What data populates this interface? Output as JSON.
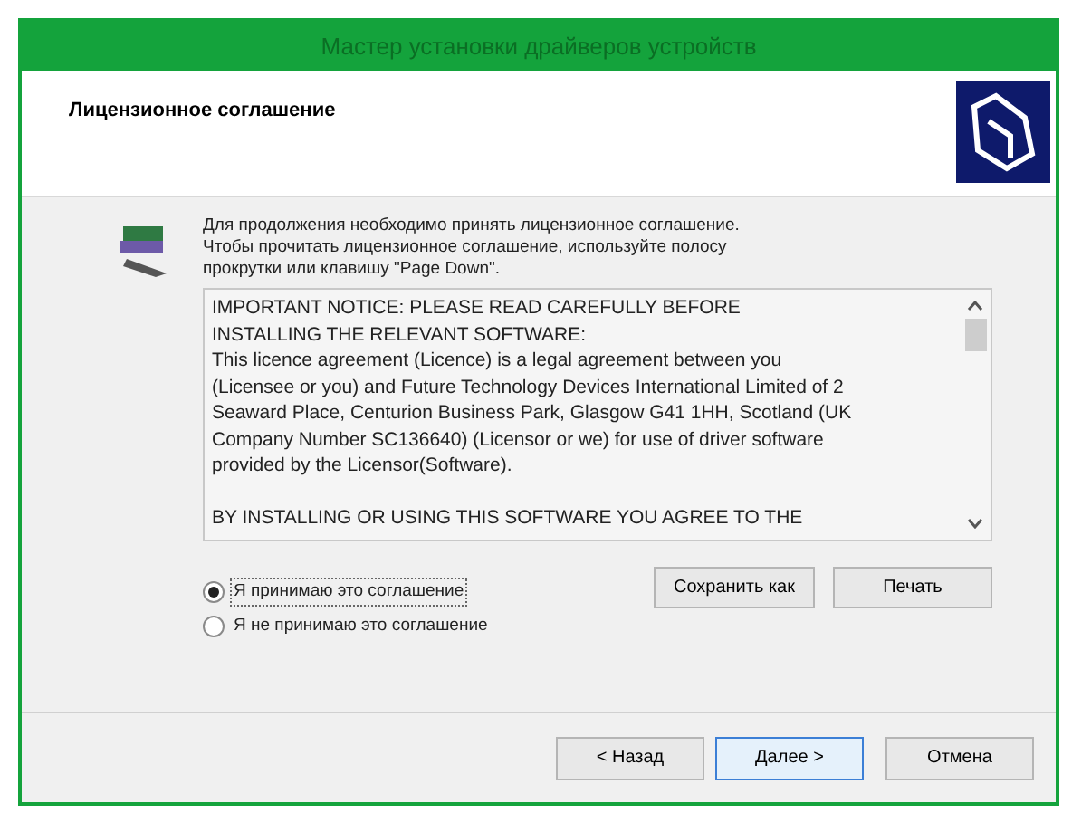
{
  "window": {
    "title": "Мастер установки драйверов устройств"
  },
  "header": {
    "title": "Лицензионное соглашение"
  },
  "instructions": [
    "Для продолжения необходимо принять лицензионное соглашение.",
    "Чтобы прочитать лицензионное соглашение, используйте полосу",
    "прокрутки или клавишу \"Page Down\"."
  ],
  "license_paragraphs": [
    [
      "IMPORTANT NOTICE: PLEASE READ CAREFULLY BEFORE",
      "INSTALLING THE RELEVANT SOFTWARE:",
      "This licence agreement (Licence) is a legal agreement between you",
      "(Licensee or you) and Future Technology Devices International Limited of 2",
      "Seaward Place, Centurion Business Park, Glasgow G41 1HH, Scotland (UK",
      "Company Number SC136640) (Licensor or we) for use of driver software",
      "provided by the Licensor(Software)."
    ],
    [
      "BY INSTALLING OR USING THIS SOFTWARE YOU AGREE TO THE"
    ]
  ],
  "options": [
    {
      "label": "Я принимаю это соглашение",
      "selected": true
    },
    {
      "label": "Я не принимаю это соглашение",
      "selected": false
    }
  ],
  "side_buttons": [
    "Сохранить как",
    "Печать"
  ],
  "footer_buttons": [
    {
      "label": "< Назад",
      "default": false
    },
    {
      "label": "Далее >",
      "default": true
    },
    {
      "label": "Отмена",
      "default": false
    }
  ]
}
